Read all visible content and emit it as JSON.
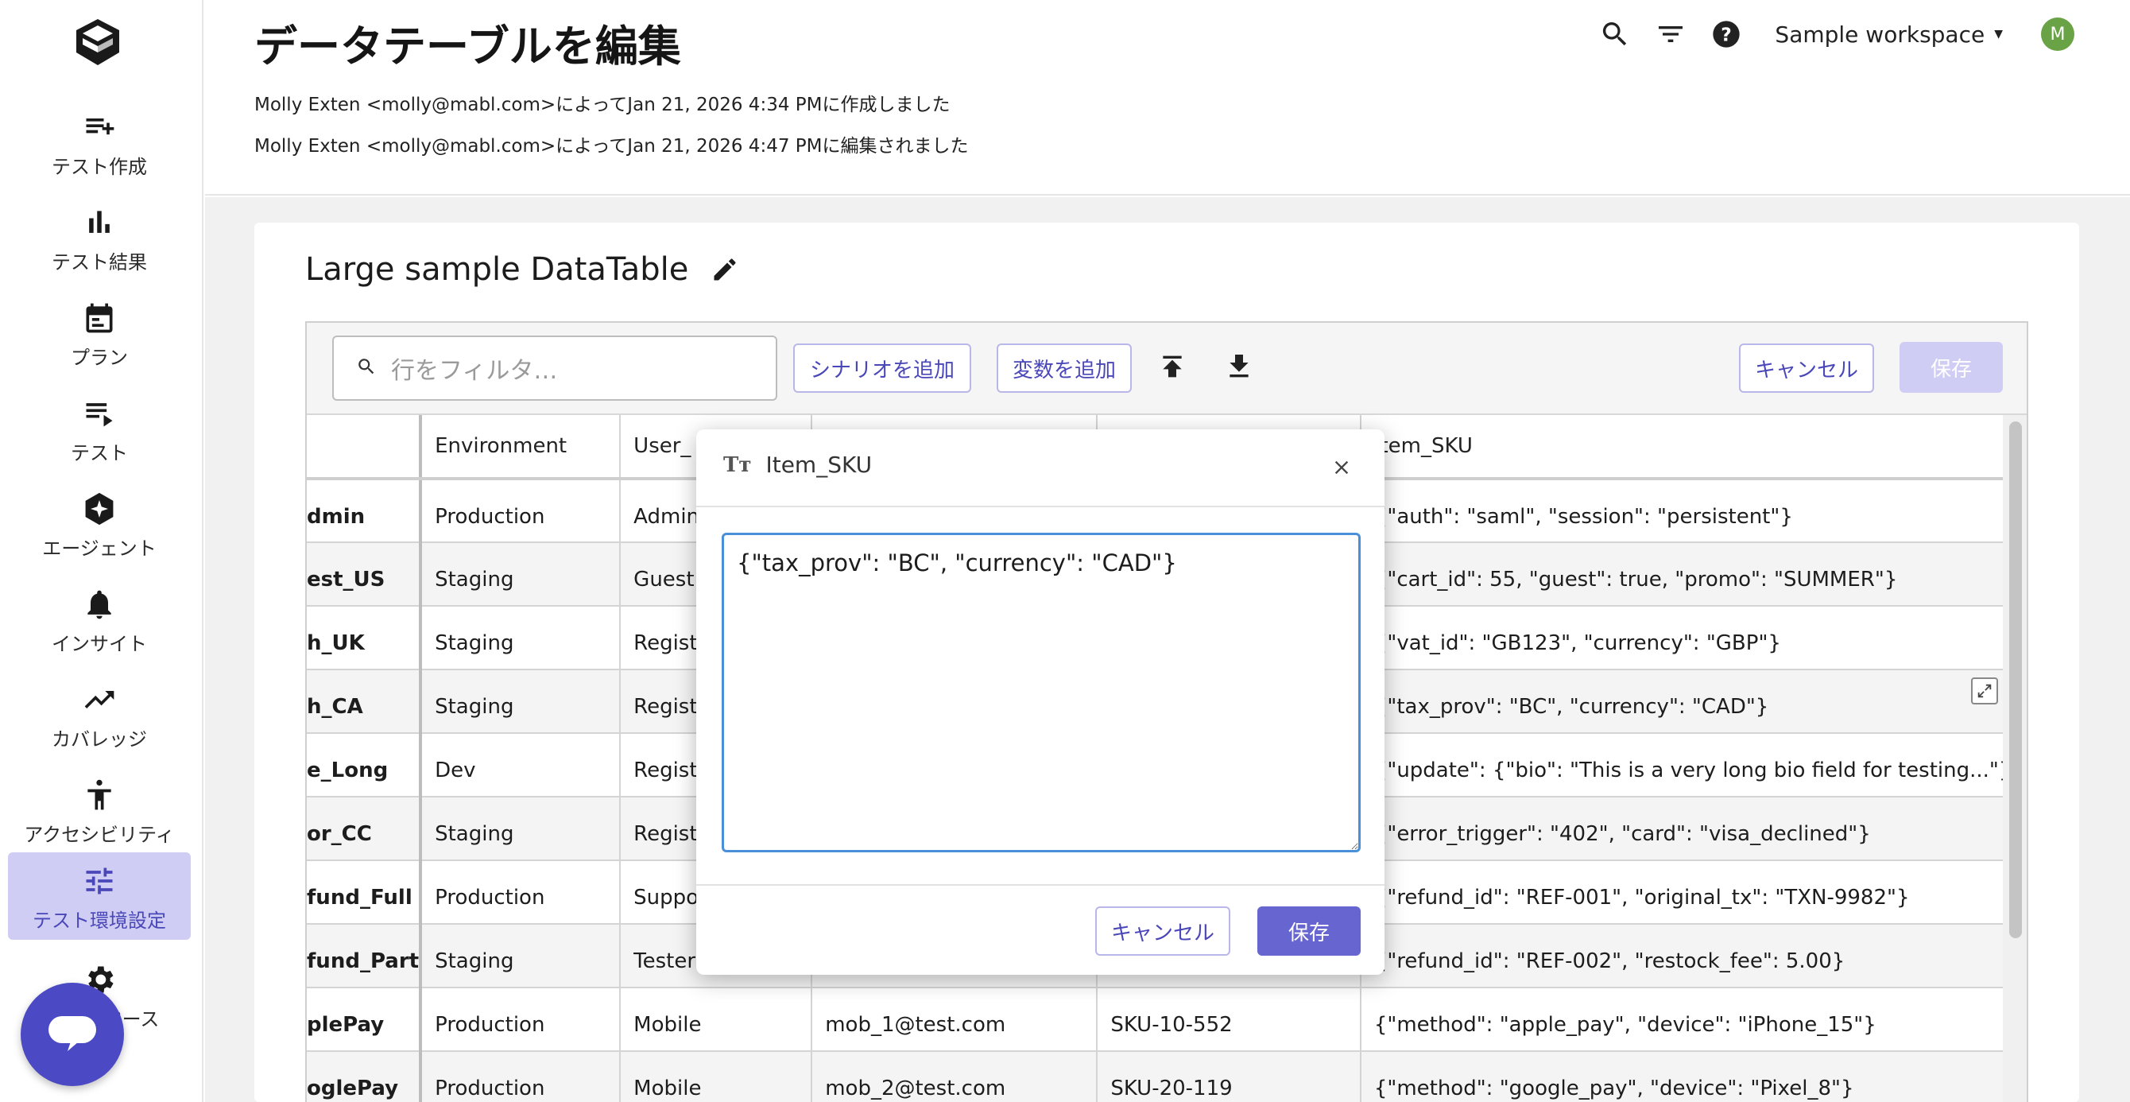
{
  "header": {
    "title": "データテーブルを編集",
    "created": "Molly Exten <molly@mabl.com>によってJan 21, 2026 4:34 PMに作成しました",
    "edited": "Molly Exten <molly@mabl.com>によってJan 21, 2026 4:47 PMに編集されました",
    "workspace": "Sample workspace",
    "avatar_initial": "M"
  },
  "sidebar": {
    "items": [
      {
        "label": "テスト作成",
        "icon": "create-test-icon"
      },
      {
        "label": "テスト結果",
        "icon": "bar-chart-icon"
      },
      {
        "label": "プラン",
        "icon": "calendar-icon"
      },
      {
        "label": "テスト",
        "icon": "test-list-icon"
      },
      {
        "label": "エージェント",
        "icon": "agent-icon"
      },
      {
        "label": "インサイト",
        "icon": "bell-icon"
      },
      {
        "label": "カバレッジ",
        "icon": "trend-icon"
      },
      {
        "label": "アクセシビリティ",
        "icon": "accessibility-icon"
      },
      {
        "label": "テスト環境設定",
        "icon": "sliders-icon",
        "active": true
      },
      {
        "label": "ペース",
        "icon": "gear-icon"
      }
    ]
  },
  "card": {
    "title": "Large sample DataTable"
  },
  "toolbar": {
    "filter_placeholder": "行をフィルタ…",
    "add_scenario": "シナリオを追加",
    "add_variable": "変数を追加",
    "cancel": "キャンセル",
    "save": "保存"
  },
  "table": {
    "columns": [
      "",
      "Environment",
      "User_",
      "",
      "",
      "Item_SKU"
    ],
    "rows": [
      [
        "dmin",
        "Production",
        "Admin",
        "",
        "",
        "{\"auth\": \"saml\", \"session\": \"persistent\"}"
      ],
      [
        "est_US",
        "Staging",
        "Guest",
        "",
        "",
        "{\"cart_id\": 55, \"guest\": true, \"promo\": \"SUMMER\"}"
      ],
      [
        "h_UK",
        "Staging",
        "Registe",
        "",
        "",
        "{\"vat_id\": \"GB123\", \"currency\": \"GBP\"}"
      ],
      [
        "h_CA",
        "Staging",
        "Registe",
        "",
        "",
        "{\"tax_prov\": \"BC\", \"currency\": \"CAD\"}"
      ],
      [
        "e_Long",
        "Dev",
        "Registe",
        "",
        "",
        "{\"update\": {\"bio\": \"This is a very long bio field for testing...\"}}"
      ],
      [
        "or_CC",
        "Staging",
        "Registe",
        "",
        "",
        "{\"error_trigger\": \"402\", \"card\": \"visa_declined\"}"
      ],
      [
        "fund_Full",
        "Production",
        "Suppor",
        "",
        "",
        "{\"refund_id\": \"REF-001\", \"original_tx\": \"TXN-9982\"}"
      ],
      [
        "fund_Part",
        "Staging",
        "Tester",
        "",
        "",
        "{\"refund_id\": \"REF-002\", \"restock_fee\": 5.00}"
      ],
      [
        "plePay",
        "Production",
        "Mobile",
        "mob_1@test.com",
        "SKU-10-552",
        "{\"method\": \"apple_pay\", \"device\": \"iPhone_15\"}"
      ],
      [
        "oglePay",
        "Production",
        "Mobile",
        "mob_2@test.com",
        "SKU-20-119",
        "{\"method\": \"google_pay\", \"device\": \"Pixel_8\"}"
      ]
    ]
  },
  "modal": {
    "title": "Item_SKU",
    "type_icon": "Tт",
    "value": "{\"tax_prov\": \"BC\", \"currency\": \"CAD\"}",
    "cancel": "キャンセル",
    "save": "保存"
  }
}
